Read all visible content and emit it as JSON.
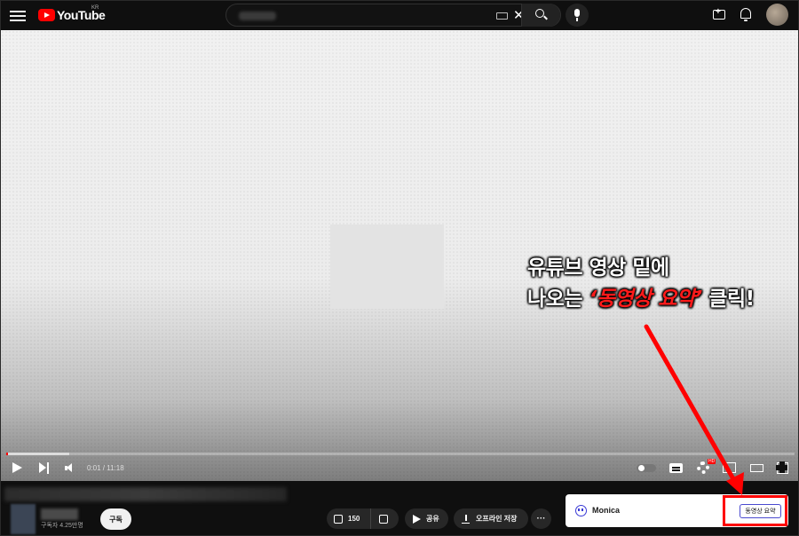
{
  "header": {
    "logo_text": "YouTube",
    "logo_region": "KR"
  },
  "player": {
    "time_display": "0:01 / 11:18",
    "progress_fraction": 0.0015,
    "buffer_fraction": 0.08,
    "settings_badge": "HD"
  },
  "annotation": {
    "line1": "유튜브 영상 밑에",
    "line2_prefix": "나오는 ",
    "line2_highlight": "‘동영상 요약’",
    "line2_suffix": " 클릭!",
    "highlight_color": "#ff1a1a"
  },
  "below_video": {
    "sub_count": "구독자 4.25만명",
    "subscribe_label": "구독",
    "like_count": "150",
    "share_label": "공유",
    "download_label": "오프라인 저장",
    "more_label": "···"
  },
  "monica": {
    "name": "Monica",
    "summary_button": "동영상 요약"
  },
  "colors": {
    "brand_red": "#ff0000",
    "background": "#0f0f0f",
    "monica_accent": "#3b3bd6"
  }
}
